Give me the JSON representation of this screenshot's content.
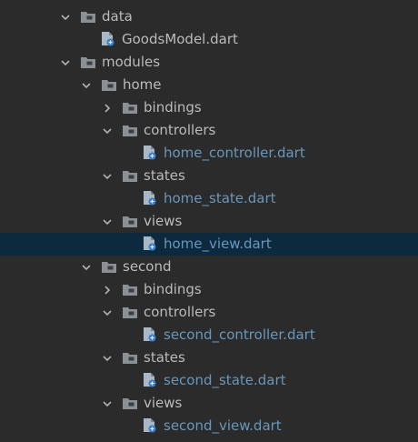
{
  "project_tree": {
    "rows": [
      {
        "label": "data",
        "kind": "folder",
        "expanded": true,
        "selected": false
      },
      {
        "label": "GoodsModel.dart",
        "kind": "dart-file",
        "selected": false
      },
      {
        "label": "modules",
        "kind": "folder",
        "expanded": true,
        "selected": false
      },
      {
        "label": "home",
        "kind": "folder",
        "expanded": true,
        "selected": false
      },
      {
        "label": "bindings",
        "kind": "folder",
        "expanded": false,
        "selected": false
      },
      {
        "label": "controllers",
        "kind": "folder",
        "expanded": true,
        "selected": false
      },
      {
        "label": "home_controller.dart",
        "kind": "dart-file",
        "selected": false
      },
      {
        "label": "states",
        "kind": "folder",
        "expanded": true,
        "selected": false
      },
      {
        "label": "home_state.dart",
        "kind": "dart-file",
        "selected": false
      },
      {
        "label": "views",
        "kind": "folder",
        "expanded": true,
        "selected": false
      },
      {
        "label": "home_view.dart",
        "kind": "dart-file",
        "selected": true
      },
      {
        "label": "second",
        "kind": "folder",
        "expanded": true,
        "selected": false
      },
      {
        "label": "bindings",
        "kind": "folder",
        "expanded": false,
        "selected": false
      },
      {
        "label": "controllers",
        "kind": "folder",
        "expanded": true,
        "selected": false
      },
      {
        "label": "second_controller.dart",
        "kind": "dart-file",
        "selected": false
      },
      {
        "label": "states",
        "kind": "folder",
        "expanded": true,
        "selected": false
      },
      {
        "label": "second_state.dart",
        "kind": "dart-file",
        "selected": false
      },
      {
        "label": "views",
        "kind": "folder",
        "expanded": true,
        "selected": false
      },
      {
        "label": "second_view.dart",
        "kind": "dart-file",
        "selected": false
      }
    ]
  },
  "colors": {
    "background": "#2b2b2b",
    "selection": "#0d293e",
    "folder_text": "#bbbbbb",
    "tracked_file_text": "#6897bb",
    "folder_icon": "#8c8f93",
    "dart_badge": "#3d7fc4"
  }
}
